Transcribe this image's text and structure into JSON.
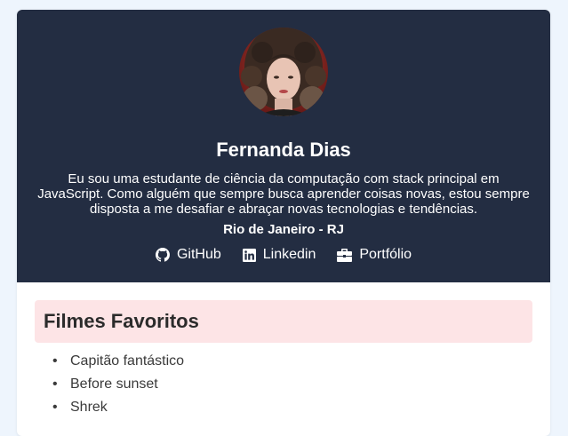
{
  "profile": {
    "name": "Fernanda Dias",
    "bio": "Eu sou uma estudante de ciência da computação com stack principal em JavaScript. Como alguém que sempre busca aprender coisas novas, estou sempre disposta a me desafiar e abraçar novas tecnologias e tendências.",
    "location": "Rio de Janeiro - RJ",
    "avatar_icon": "profile-photo"
  },
  "links": [
    {
      "label": "GitHub",
      "icon": "github-icon"
    },
    {
      "label": "Linkedin",
      "icon": "linkedin-icon"
    },
    {
      "label": "Portfólio",
      "icon": "briefcase-icon"
    }
  ],
  "favorites": {
    "title": "Filmes Favoritos",
    "items": [
      "Capitão fantástico",
      "Before sunset",
      "Shrek"
    ]
  },
  "colors": {
    "header_bg": "#232d42",
    "page_bg": "#eef5fd",
    "section_title_bg": "#fde4e6"
  }
}
